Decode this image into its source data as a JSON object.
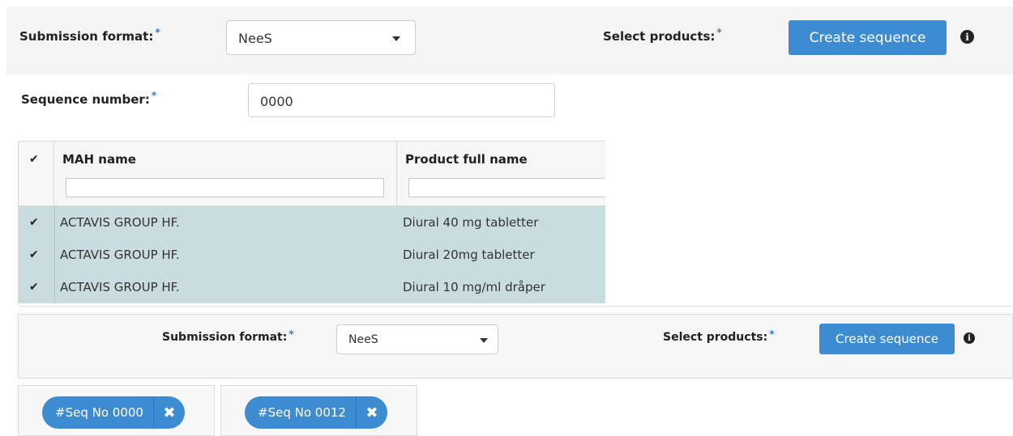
{
  "top": {
    "submission_format_label": "Submission format:",
    "required_mark": "*",
    "submission_format_value": "NeeS",
    "select_products_label": "Select products:",
    "create_sequence_label": "Create sequence",
    "info_icon_glyph": "i",
    "sequence_number_label": "Sequence number:",
    "sequence_number_value": "0000"
  },
  "grid": {
    "columns": [
      "MAH name",
      "Product full name"
    ],
    "check_glyph": "✔",
    "rows": [
      {
        "selected": true,
        "mah": "ACTAVIS GROUP HF.",
        "product": "Diural 40 mg tabletter"
      },
      {
        "selected": true,
        "mah": "ACTAVIS GROUP HF.",
        "product": "Diural 20mg tabletter"
      },
      {
        "selected": true,
        "mah": "ACTAVIS GROUP HF.",
        "product": "Diural 10 mg/ml dråper"
      }
    ]
  },
  "bottom": {
    "submission_format_label": "Submission format:",
    "required_mark": "*",
    "submission_format_value": "NeeS",
    "select_products_label": "Select products:",
    "create_sequence_label": "Create sequence",
    "info_icon_glyph": "i"
  },
  "sequences": [
    {
      "label": "#Seq No 0000",
      "remove_glyph": "✖"
    },
    {
      "label": "#Seq No 0012",
      "remove_glyph": "✖"
    }
  ],
  "colors": {
    "accent": "#3d8bd1",
    "row_selected": "#c9dcdf",
    "panel_bg": "#f5f5f5"
  },
  "icons": {
    "dropdown": "caret-down-icon",
    "info": "info-circle-icon",
    "check": "check-icon",
    "remove": "close-icon"
  }
}
